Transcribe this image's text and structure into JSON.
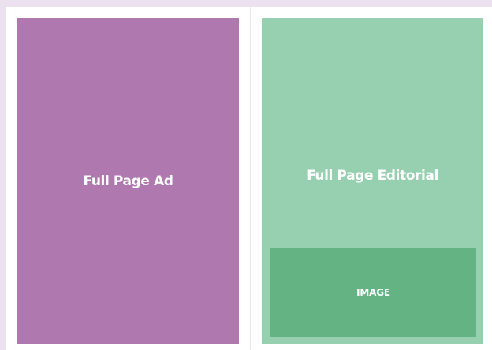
{
  "layout": {
    "left_page": {
      "label": "Full Page Ad",
      "color": "#af79b0"
    },
    "right_page": {
      "label": "Full Page Editorial",
      "color": "#96d0b0",
      "image": {
        "label": "IMAGE",
        "color": "#63b383"
      }
    }
  },
  "colors": {
    "background": "#ece1ef",
    "spread": "#ffffff",
    "text": "#ffffff"
  }
}
